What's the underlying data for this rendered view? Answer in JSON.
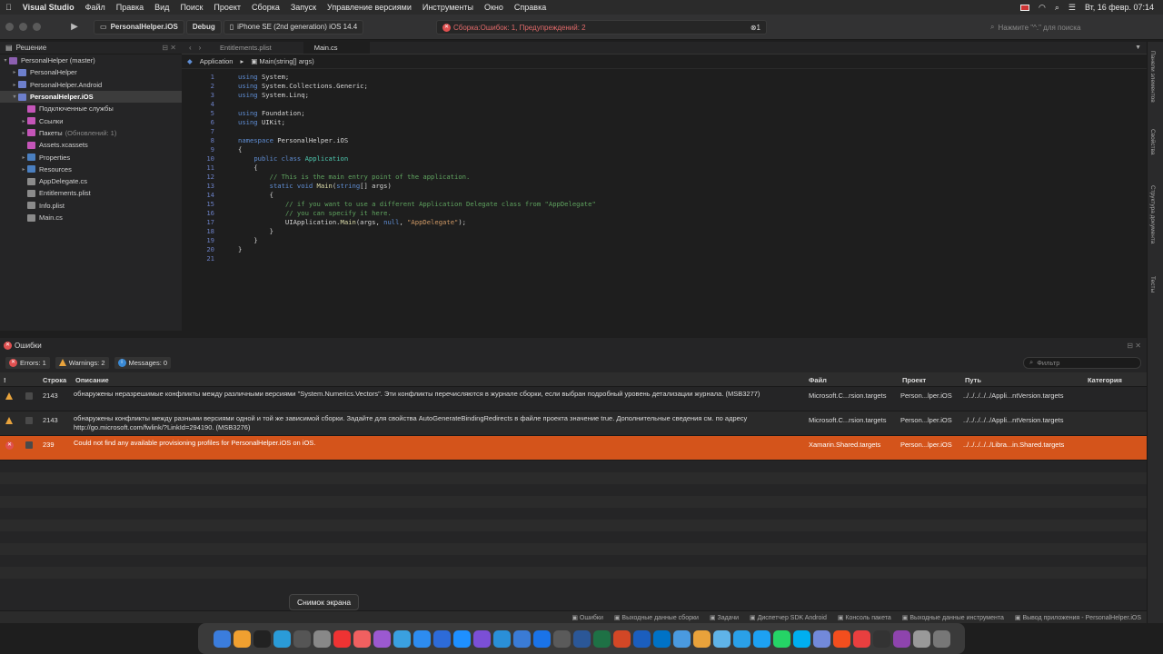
{
  "menubar": {
    "apple": "",
    "app": "Visual Studio",
    "items": [
      "Файл",
      "Правка",
      "Вид",
      "Поиск",
      "Проект",
      "Сборка",
      "Запуск",
      "Управление версиями",
      "Инструменты",
      "Окно",
      "Справка"
    ],
    "datetime": "Вт, 16 февр.  07:14"
  },
  "toolbar": {
    "config": "Debug",
    "project": "PersonalHelper.iOS",
    "device": "iPhone SE (2nd generation) iOS 14.4",
    "status": "Сборка:Ошибок: 1, Предупреждений: 2",
    "status_count": "1",
    "search_placeholder": "Нажмите \"^.\" для поиска"
  },
  "solution": {
    "title": "Решение",
    "items": [
      {
        "label": "PersonalHelper (master)",
        "indent": 0,
        "arrow": "▾",
        "icon": "sln"
      },
      {
        "label": "PersonalHelper",
        "indent": 1,
        "arrow": "▸",
        "icon": "proj"
      },
      {
        "label": "PersonalHelper.Android",
        "indent": 1,
        "arrow": "▸",
        "icon": "proj"
      },
      {
        "label": "PersonalHelper.iOS",
        "indent": 1,
        "arrow": "▾",
        "icon": "proj",
        "selected": true
      },
      {
        "label": "Подключенные службы",
        "indent": 2,
        "arrow": "",
        "icon": "pink"
      },
      {
        "label": "Ссылки",
        "indent": 2,
        "arrow": "▸",
        "icon": "pink"
      },
      {
        "label": "Пакеты",
        "muted": "(Обновлений: 1)",
        "indent": 2,
        "arrow": "▸",
        "icon": "pink"
      },
      {
        "label": "Assets.xcassets",
        "indent": 2,
        "arrow": "",
        "icon": "pink"
      },
      {
        "label": "Properties",
        "indent": 2,
        "arrow": "▸",
        "icon": "fold"
      },
      {
        "label": "Resources",
        "indent": 2,
        "arrow": "▸",
        "icon": "fold"
      },
      {
        "label": "AppDelegate.cs",
        "indent": 2,
        "arrow": "",
        "icon": "file"
      },
      {
        "label": "Entitlements.plist",
        "indent": 2,
        "arrow": "",
        "icon": "file"
      },
      {
        "label": "Info.plist",
        "indent": 2,
        "arrow": "",
        "icon": "file"
      },
      {
        "label": "Main.cs",
        "indent": 2,
        "arrow": "",
        "icon": "file"
      }
    ]
  },
  "editor": {
    "tabs": [
      "Entitlements.plist",
      "Main.cs"
    ],
    "active_tab": 1,
    "crumb_class": "Application",
    "crumb_method": "Main(string[] args)",
    "lines": [
      [
        [
          "kw",
          "using"
        ],
        [
          "ref",
          " System;"
        ]
      ],
      [
        [
          "kw",
          "using"
        ],
        [
          "ref",
          " System.Collections.Generic;"
        ]
      ],
      [
        [
          "kw",
          "using"
        ],
        [
          "ref",
          " System.Linq;"
        ]
      ],
      [],
      [
        [
          "kw",
          "using"
        ],
        [
          "ref",
          " Foundation;"
        ]
      ],
      [
        [
          "kw",
          "using"
        ],
        [
          "ref",
          " UIKit;"
        ]
      ],
      [],
      [
        [
          "kw",
          "namespace"
        ],
        [
          "ref",
          " PersonalHelper.iOS"
        ]
      ],
      [
        [
          "ref",
          "{"
        ]
      ],
      [
        [
          "ref",
          "    "
        ],
        [
          "kw",
          "public class"
        ],
        [
          "ty",
          " Application"
        ]
      ],
      [
        [
          "ref",
          "    {"
        ]
      ],
      [
        [
          "ref",
          "        "
        ],
        [
          "cm",
          "// This is the main entry point of the application."
        ]
      ],
      [
        [
          "ref",
          "        "
        ],
        [
          "kw",
          "static void"
        ],
        [
          "fn",
          " Main"
        ],
        [
          "ref",
          "("
        ],
        [
          "kw",
          "string"
        ],
        [
          "ref",
          "[] args)"
        ]
      ],
      [
        [
          "ref",
          "        {"
        ]
      ],
      [
        [
          "ref",
          "            "
        ],
        [
          "cm",
          "// if you want to use a different Application Delegate class from \"AppDelegate\""
        ]
      ],
      [
        [
          "ref",
          "            "
        ],
        [
          "cm",
          "// you can specify it here."
        ]
      ],
      [
        [
          "ref",
          "            UIApplication."
        ],
        [
          "fn",
          "Main"
        ],
        [
          "ref",
          "(args, "
        ],
        [
          "kw",
          "null"
        ],
        [
          "ref",
          ", "
        ],
        [
          "st",
          "\"AppDelegate\""
        ],
        [
          "ref",
          ");"
        ]
      ],
      [
        [
          "ref",
          "        }"
        ]
      ],
      [
        [
          "ref",
          "    }"
        ]
      ],
      [
        [
          "ref",
          "}"
        ]
      ],
      []
    ]
  },
  "right_panels": [
    "Панели элементов",
    "Свойства",
    "Структура документа",
    "Тесты"
  ],
  "errors": {
    "title": "Ошибки",
    "errors_btn": "Errors: 1",
    "warnings_btn": "Warnings: 2",
    "messages_btn": "Messages: 0",
    "filter_placeholder": "Фильтр",
    "columns": [
      "!",
      "Строка",
      "Описание",
      "Файл",
      "Проект",
      "Путь",
      "Категория"
    ],
    "rows": [
      {
        "type": "warning",
        "line": "2143",
        "desc": "обнаружены неразрешимые конфликты между различными версиями \"System.Numerics.Vectors\". Эти конфликты перечисляются в журнале сборки, если выбран подробный уровень детализации журнала. (MSB3277)",
        "file": "Microsoft.C...rsion.targets",
        "project": "Person...lper.iOS",
        "path": "../../../../../Appli...ntVersion.targets"
      },
      {
        "type": "warning",
        "line": "2143",
        "desc": "обнаружены конфликты между разными версиями одной и той же зависимой сборки. Задайте для свойства AutoGenerateBindingRedirects в файле проекта значение true. Дополнительные сведения см. по адресу http://go.microsoft.com/fwlink/?LinkId=294190. (MSB3276)",
        "file": "Microsoft.C...rsion.targets",
        "project": "Person...lper.iOS",
        "path": "../../../../../Appli...ntVersion.targets"
      },
      {
        "type": "error",
        "line": "239",
        "desc": "Could not find any available provisioning profiles for PersonalHelper.iOS on iOS.",
        "file": "Xamarin.Shared.targets",
        "project": "Person...lper.iOS",
        "path": "../../../../../Libra...in.Shared.targets"
      }
    ]
  },
  "bottom_pads": [
    "Ошибки",
    "Выходные данные сборки",
    "Задачи",
    "Диспетчер SDK Android",
    "Консоль пакета",
    "Выходные данные инструмента",
    "Вывод приложения - PersonalHelper.iOS"
  ],
  "tooltip": "Снимок экрана",
  "dock_colors": [
    "#3b7ddd",
    "#f0a030",
    "#222",
    "#2a9bd8",
    "#555",
    "#888",
    "#e33",
    "#f06060",
    "#9b59d0",
    "#3aa0e0",
    "#2d8cf0",
    "#2d6bd8",
    "#1e90ff",
    "#7b4fd6",
    "#2a8fd8",
    "#3a7bd5",
    "#1a73e8",
    "#5a5a5a",
    "#2b5797",
    "#1e7145",
    "#d24726",
    "#1b5ebe",
    "#0072c6",
    "#4a9ae0",
    "#e9a23b",
    "#5fb3e8",
    "#2aa0e8",
    "#1da1f2",
    "#25d366",
    "#00aff0",
    "#7289da",
    "#f24e1e",
    "#e83f3f",
    "#333",
    "#8e44ad",
    "#999",
    "#777"
  ]
}
